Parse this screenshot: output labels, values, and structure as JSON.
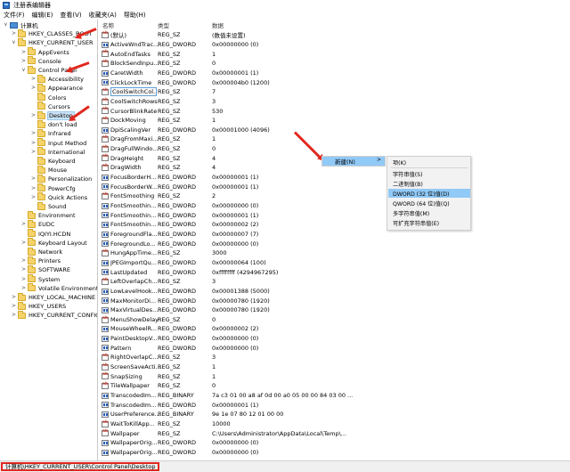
{
  "window": {
    "title": "注册表编辑器"
  },
  "menu": [
    "文件(F)",
    "编辑(E)",
    "查看(V)",
    "收藏夹(A)",
    "帮助(H)"
  ],
  "tree": [
    {
      "label": "计算机",
      "arrow": "∨",
      "type": "pc",
      "level": 0
    },
    {
      "label": "HKEY_CLASSES_ROOT",
      "arrow": ">",
      "type": "folder",
      "level": 1
    },
    {
      "label": "HKEY_CURRENT_USER",
      "arrow": "∨",
      "type": "folder",
      "level": 1
    },
    {
      "label": "AppEvents",
      "arrow": ">",
      "type": "folder",
      "level": 2
    },
    {
      "label": "Console",
      "arrow": ">",
      "type": "folder",
      "level": 2
    },
    {
      "label": "Control Panel",
      "arrow": "∨",
      "type": "folder",
      "level": 2
    },
    {
      "label": "Accessibility",
      "arrow": ">",
      "type": "folder",
      "level": 3
    },
    {
      "label": "Appearance",
      "arrow": ">",
      "type": "folder",
      "level": 3
    },
    {
      "label": "Colors",
      "arrow": "",
      "type": "folder",
      "level": 3
    },
    {
      "label": "Cursors",
      "arrow": "",
      "type": "folder",
      "level": 3
    },
    {
      "label": "Desktop",
      "arrow": ">",
      "type": "folder",
      "level": 3,
      "selected": true
    },
    {
      "label": "don't load",
      "arrow": "",
      "type": "folder",
      "level": 3
    },
    {
      "label": "Infrared",
      "arrow": ">",
      "type": "folder",
      "level": 3
    },
    {
      "label": "Input Method",
      "arrow": ">",
      "type": "folder",
      "level": 3
    },
    {
      "label": "International",
      "arrow": ">",
      "type": "folder",
      "level": 3
    },
    {
      "label": "Keyboard",
      "arrow": "",
      "type": "folder",
      "level": 3
    },
    {
      "label": "Mouse",
      "arrow": "",
      "type": "folder",
      "level": 3
    },
    {
      "label": "Personalization",
      "arrow": ">",
      "type": "folder",
      "level": 3
    },
    {
      "label": "PowerCfg",
      "arrow": ">",
      "type": "folder",
      "level": 3
    },
    {
      "label": "Quick Actions",
      "arrow": ">",
      "type": "folder",
      "level": 3
    },
    {
      "label": "Sound",
      "arrow": "",
      "type": "folder",
      "level": 3
    },
    {
      "label": "Environment",
      "arrow": "",
      "type": "folder",
      "level": 2
    },
    {
      "label": "EUDC",
      "arrow": ">",
      "type": "folder",
      "level": 2
    },
    {
      "label": "IQIYI.HCDN",
      "arrow": "",
      "type": "folder",
      "level": 2
    },
    {
      "label": "Keyboard Layout",
      "arrow": ">",
      "type": "folder",
      "level": 2
    },
    {
      "label": "Network",
      "arrow": "",
      "type": "folder",
      "level": 2
    },
    {
      "label": "Printers",
      "arrow": ">",
      "type": "folder",
      "level": 2
    },
    {
      "label": "SOFTWARE",
      "arrow": ">",
      "type": "folder",
      "level": 2
    },
    {
      "label": "System",
      "arrow": ">",
      "type": "folder",
      "level": 2
    },
    {
      "label": "Volatile Environment",
      "arrow": ">",
      "type": "folder",
      "level": 2
    },
    {
      "label": "HKEY_LOCAL_MACHINE",
      "arrow": ">",
      "type": "folder",
      "level": 1
    },
    {
      "label": "HKEY_USERS",
      "arrow": ">",
      "type": "folder",
      "level": 1
    },
    {
      "label": "HKEY_CURRENT_CONFIG",
      "arrow": ">",
      "type": "folder",
      "level": 1
    }
  ],
  "columns": {
    "name": "名称",
    "type": "类型",
    "data": "数据"
  },
  "values": [
    {
      "name": "(默认)",
      "type": "REG_SZ",
      "data": "(数值未设置)",
      "icon": "sz"
    },
    {
      "name": "ActiveWndTrac...",
      "type": "REG_DWORD",
      "data": "0x00000000 (0)",
      "icon": "bin"
    },
    {
      "name": "AutoEndTasks",
      "type": "REG_SZ",
      "data": "1",
      "icon": "sz"
    },
    {
      "name": "BlockSendInpu...",
      "type": "REG_SZ",
      "data": "0",
      "icon": "sz"
    },
    {
      "name": "CaretWidth",
      "type": "REG_DWORD",
      "data": "0x00000001 (1)",
      "icon": "bin"
    },
    {
      "name": "ClickLockTime",
      "type": "REG_DWORD",
      "data": "0x000004b0 (1200)",
      "icon": "bin"
    },
    {
      "name": "CoolSwitchCol...",
      "type": "REG_SZ",
      "data": "7",
      "icon": "sz",
      "selected": true
    },
    {
      "name": "CoolSwitchRows",
      "type": "REG_SZ",
      "data": "3",
      "icon": "sz"
    },
    {
      "name": "CursorBlinkRate",
      "type": "REG_SZ",
      "data": "530",
      "icon": "sz"
    },
    {
      "name": "DockMoving",
      "type": "REG_SZ",
      "data": "1",
      "icon": "sz"
    },
    {
      "name": "DpiScalingVer",
      "type": "REG_DWORD",
      "data": "0x00001000 (4096)",
      "icon": "bin"
    },
    {
      "name": "DragFromMaxi...",
      "type": "REG_SZ",
      "data": "1",
      "icon": "sz"
    },
    {
      "name": "DragFullWindo...",
      "type": "REG_SZ",
      "data": "0",
      "icon": "sz"
    },
    {
      "name": "DragHeight",
      "type": "REG_SZ",
      "data": "4",
      "icon": "sz"
    },
    {
      "name": "DragWidth",
      "type": "REG_SZ",
      "data": "4",
      "icon": "sz"
    },
    {
      "name": "FocusBorderH...",
      "type": "REG_DWORD",
      "data": "0x00000001 (1)",
      "icon": "bin"
    },
    {
      "name": "FocusBorderW...",
      "type": "REG_DWORD",
      "data": "0x00000001 (1)",
      "icon": "bin"
    },
    {
      "name": "FontSmoothing",
      "type": "REG_SZ",
      "data": "2",
      "icon": "sz"
    },
    {
      "name": "FontSmoothin...",
      "type": "REG_DWORD",
      "data": "0x00000000 (0)",
      "icon": "bin"
    },
    {
      "name": "FontSmoothin...",
      "type": "REG_DWORD",
      "data": "0x00000001 (1)",
      "icon": "bin"
    },
    {
      "name": "FontSmoothin...",
      "type": "REG_DWORD",
      "data": "0x00000002 (2)",
      "icon": "bin"
    },
    {
      "name": "ForegroundFla...",
      "type": "REG_DWORD",
      "data": "0x00000007 (7)",
      "icon": "bin"
    },
    {
      "name": "ForegroundLo...",
      "type": "REG_DWORD",
      "data": "0x00000000 (0)",
      "icon": "bin"
    },
    {
      "name": "HungAppTime...",
      "type": "REG_SZ",
      "data": "3000",
      "icon": "sz"
    },
    {
      "name": "JPEGImportQu...",
      "type": "REG_DWORD",
      "data": "0x00000064 (100)",
      "icon": "bin"
    },
    {
      "name": "LastUpdated",
      "type": "REG_DWORD",
      "data": "0xffffffff (4294967295)",
      "icon": "bin"
    },
    {
      "name": "LeftOverlapCh...",
      "type": "REG_SZ",
      "data": "3",
      "icon": "sz"
    },
    {
      "name": "LowLevelHook...",
      "type": "REG_DWORD",
      "data": "0x00001388 (5000)",
      "icon": "bin"
    },
    {
      "name": "MaxMonitorDi...",
      "type": "REG_DWORD",
      "data": "0x00000780 (1920)",
      "icon": "bin"
    },
    {
      "name": "MaxVirtualDes...",
      "type": "REG_DWORD",
      "data": "0x00000780 (1920)",
      "icon": "bin"
    },
    {
      "name": "MenuShowDelay",
      "type": "REG_SZ",
      "data": "0",
      "icon": "sz"
    },
    {
      "name": "MouseWheelR...",
      "type": "REG_DWORD",
      "data": "0x00000002 (2)",
      "icon": "bin"
    },
    {
      "name": "PaintDesktopV...",
      "type": "REG_DWORD",
      "data": "0x00000000 (0)",
      "icon": "bin"
    },
    {
      "name": "Pattern",
      "type": "REG_DWORD",
      "data": "0x00000000 (0)",
      "icon": "bin"
    },
    {
      "name": "RightOverlapC...",
      "type": "REG_SZ",
      "data": "3",
      "icon": "sz"
    },
    {
      "name": "ScreenSaveActi...",
      "type": "REG_SZ",
      "data": "1",
      "icon": "sz"
    },
    {
      "name": "SnapSizing",
      "type": "REG_SZ",
      "data": "1",
      "icon": "sz"
    },
    {
      "name": "TileWallpaper",
      "type": "REG_SZ",
      "data": "0",
      "icon": "sz"
    },
    {
      "name": "TranscodedIm...",
      "type": "REG_BINARY",
      "data": "7a c3 01 00 a8 af 0d 00 a0 05 00 00 84 03 00 ...",
      "icon": "bin"
    },
    {
      "name": "TranscodedIm...",
      "type": "REG_DWORD",
      "data": "0x00000001 (1)",
      "icon": "bin"
    },
    {
      "name": "UserPreference...",
      "type": "REG_BINARY",
      "data": "9e 1e 07 80 12 01 00 00",
      "icon": "bin"
    },
    {
      "name": "WaitToKillApp...",
      "type": "REG_SZ",
      "data": "10000",
      "icon": "sz"
    },
    {
      "name": "Wallpaper",
      "type": "REG_SZ",
      "data": "C:\\Users\\Administrator\\AppData\\Local\\Temp\\...",
      "icon": "sz"
    },
    {
      "name": "WallpaperOrig...",
      "type": "REG_DWORD",
      "data": "0x00000000 (0)",
      "icon": "bin"
    },
    {
      "name": "WallpaperOrig...",
      "type": "REG_DWORD",
      "data": "0x00000000 (0)",
      "icon": "bin"
    }
  ],
  "context_menu": {
    "new_label": "新建(N)",
    "submenu": [
      {
        "label": "项(K)"
      },
      {
        "label": "字符串值(S)"
      },
      {
        "label": "二进制值(B)"
      },
      {
        "label": "DWORD (32 位)值(D)",
        "highlight": true
      },
      {
        "label": "QWORD (64 位)值(Q)"
      },
      {
        "label": "多字符串值(M)"
      },
      {
        "label": "可扩充字符串值(E)"
      }
    ]
  },
  "status": {
    "path": "计算机\\HKEY_CURRENT_USER\\Control Panel\\Desktop"
  },
  "colors": {
    "annotation": "#e0281f",
    "selection": "#cce4f7",
    "menu_highlight": "#91c9f7"
  }
}
